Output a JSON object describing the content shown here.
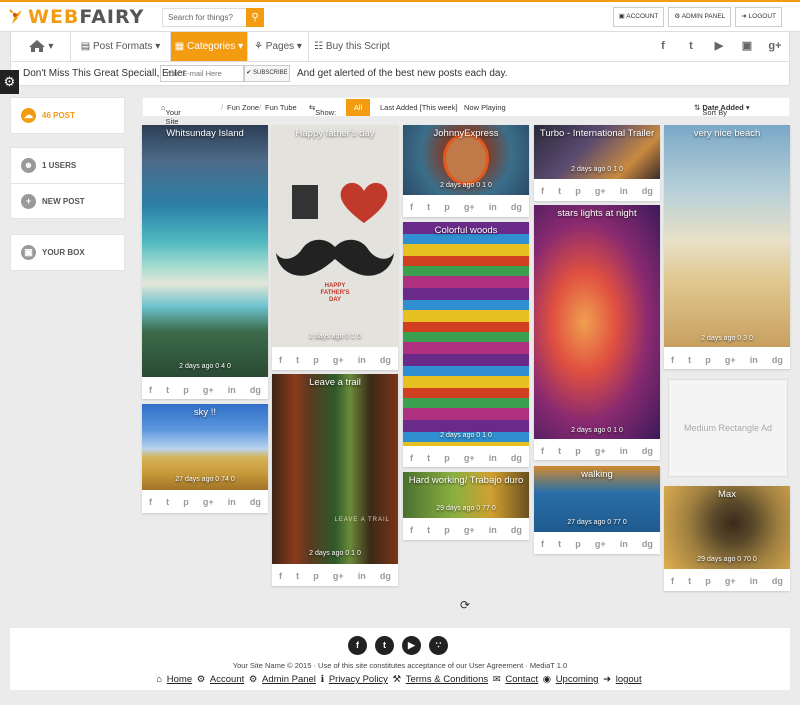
{
  "logo": {
    "part1": "WEB",
    "part2": "FAIRY"
  },
  "search": {
    "placeholder": "Search for things?"
  },
  "top_links": {
    "account": "ACCOUNT",
    "admin": "ADMIN PANEL",
    "logout": "LOGOUT"
  },
  "nav": {
    "post_formats": "Post Formats",
    "categories": "Categories",
    "pages": "Pages",
    "buy": "Buy this Script"
  },
  "alert": {
    "left": "Don't Miss This Great Speciall, Enter",
    "placeholder": "Your E-mail Here",
    "subscribe": "SUBSCRIBE",
    "right": "And get alerted of the best new posts each day."
  },
  "left": {
    "posts": "46 POST",
    "users": "1 USERS",
    "new_post": "NEW POST",
    "your_box": "YOUR BOX"
  },
  "filter": {
    "crumb1": "Your Site Name",
    "crumb2": "Fun Zone",
    "crumb3": "Fun Tube",
    "show": "Show:",
    "all": "All",
    "last": "Last Added [This week]",
    "playing": "Now Playing",
    "sort": "Sort By",
    "sort_val": "Date Added"
  },
  "posts": [
    {
      "title": "Whitsunday Island",
      "meta": "2 days ago 0 4 0"
    },
    {
      "title": "sky !!",
      "meta": "27 days ago 0 74 0"
    },
    {
      "title": "Happy father's day",
      "meta": "2 days ago 0 1 0"
    },
    {
      "title": "Leave a trail",
      "meta": "2 days ago 0 1 0"
    },
    {
      "title": "JohnnyExpress",
      "meta": "2 days ago 0 1 0"
    },
    {
      "title": "Colorful woods",
      "meta": "2 days ago 0 1 0"
    },
    {
      "title": "Hard working/ Trabajo duro",
      "meta": "29 days ago 0 77 0"
    },
    {
      "title": "Turbo - International Trailer",
      "meta": "2 days ago 0 1 0"
    },
    {
      "title": "stars lights at night",
      "meta": "2 days ago 0 1 0"
    },
    {
      "title": "walking",
      "meta": "27 days ago 0 77 0"
    },
    {
      "title": "very nice beach",
      "meta": "2 days ago 0 3 0"
    },
    {
      "title": "Max",
      "meta": "29 days ago 0 70 0"
    }
  ],
  "father_text": {
    "i": "I",
    "happy": "HAPPY",
    "fathers": "FATHER'S",
    "day": "DAY"
  },
  "trail_text": "LEAVE A TRAIL",
  "ad": "Medium Rectangle Ad",
  "footer": {
    "copy": "Your Site Name © 2015 · Use of this site constitutes acceptance of our User Agreement · MediaT 1.0",
    "home": "Home",
    "account": "Account",
    "admin": "Admin Panel",
    "privacy": "Privacy Policy",
    "terms": "Terms & Conditions",
    "contact": "Contact",
    "upcoming": "Upcoming",
    "logout": "logout"
  },
  "colors": {
    "accent": "#f39c12"
  }
}
